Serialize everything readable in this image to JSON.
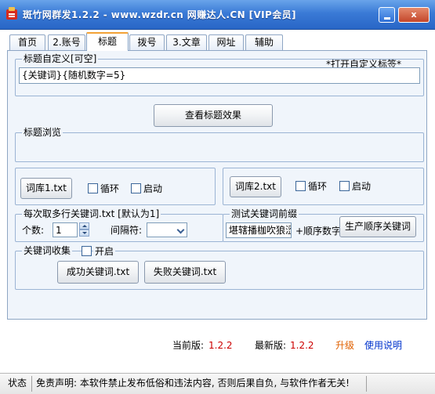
{
  "window": {
    "title": "斑竹网群发1.2.2 - www.wzdr.cn 网赚达人.CN [VIP会员]",
    "close_label": "x"
  },
  "tabs": [
    "首页",
    "2.账号",
    "标题",
    "拨号",
    "3.文章",
    "网址",
    "辅助"
  ],
  "active_tab": "标题",
  "title_group": {
    "legend": "标题自定义[可空]",
    "open_custom_tag_link": "*打开自定义标签*",
    "value": "{关键词}{随机数字=5}"
  },
  "preview_button": "查看标题效果",
  "preview_group": {
    "legend": "标题浏览"
  },
  "lexicon1": {
    "button": "词库1.txt",
    "loop_label": "循环",
    "enable_label": "启动"
  },
  "lexicon2": {
    "button": "词库2.txt",
    "loop_label": "循环",
    "enable_label": "启动"
  },
  "multiline_group": {
    "legend": "每次取多行关键词.txt [默认为1]",
    "count_label": "个数:",
    "count_value": "1",
    "separator_label": "间隔符:",
    "separator_value": ""
  },
  "prefix_group": {
    "legend": "测试关键词前缀",
    "input_value": "堪辖播枷吹狼涩",
    "order_label": "+顺序数字",
    "generate_button": "生产顺序关键词"
  },
  "collect_group": {
    "legend": "关键词收集",
    "enable_label": "开启",
    "success_button": "成功关键词.txt",
    "fail_button": "失败关键词.txt"
  },
  "version": {
    "current_label": "当前版:",
    "current_value": "1.2.2",
    "latest_label": "最新版:",
    "latest_value": "1.2.2",
    "upgrade_link": "升级",
    "help_link": "使用说明"
  },
  "statusbar": {
    "status_label": "状态",
    "disclaimer": "免责声明: 本软件禁止发布低俗和违法内容, 否则后果自负, 与软件作者无关!"
  },
  "colors": {
    "titlebar": "#2866c6",
    "accent_red": "#cc0000",
    "link_orange": "#e06000",
    "link_blue": "#0033cc",
    "panel_bg": "#f0f5fb"
  }
}
